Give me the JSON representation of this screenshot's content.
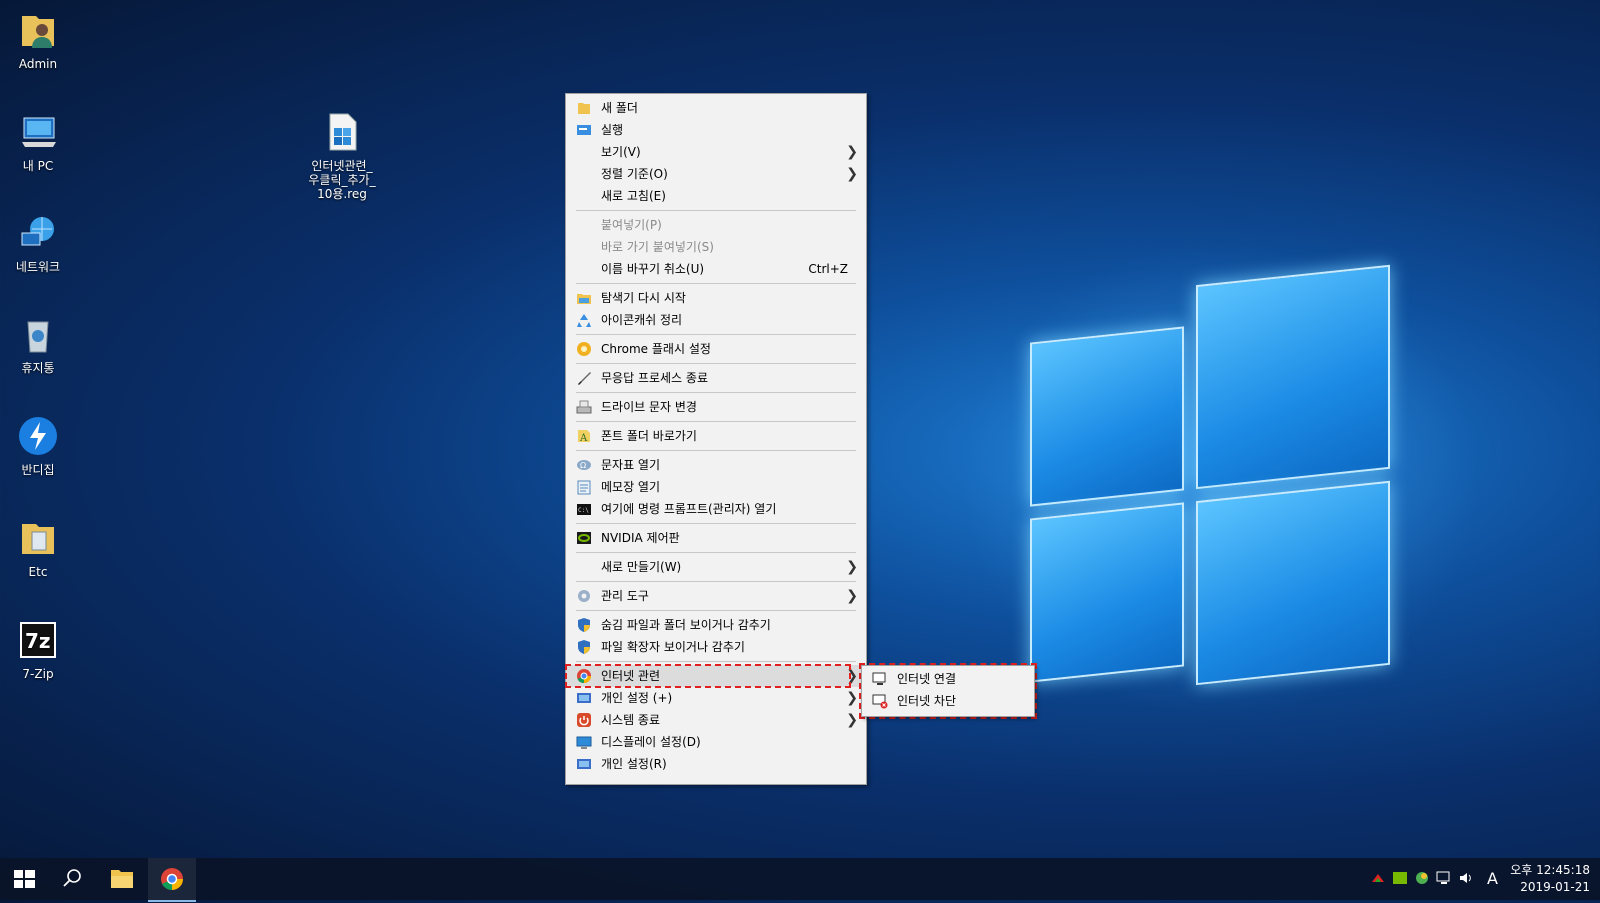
{
  "desktop": {
    "icons": [
      {
        "label": "Admin"
      },
      {
        "label": "내 PC"
      },
      {
        "label": "네트워크"
      },
      {
        "label": "휴지통"
      },
      {
        "label": "반디집"
      },
      {
        "label": "Etc"
      },
      {
        "label": "7-Zip"
      }
    ],
    "file_icon": {
      "line1": "인터넷관련_",
      "line2": "우클릭_추가_",
      "line3": "10용.reg"
    }
  },
  "context_menu": {
    "items": [
      {
        "label": "새 폴더",
        "icon": "folder-icon"
      },
      {
        "label": "실행",
        "icon": "run-icon"
      },
      {
        "label": "보기(V)",
        "submenu": true
      },
      {
        "label": "정렬 기준(O)",
        "submenu": true
      },
      {
        "label": "새로 고침(E)"
      },
      {
        "label": "붙여넣기(P)",
        "disabled": true
      },
      {
        "label": "바로 가기 붙여넣기(S)",
        "disabled": true
      },
      {
        "label": "이름 바꾸기 취소(U)",
        "shortcut": "Ctrl+Z"
      },
      {
        "label": "탐색기 다시 시작",
        "icon": "explorer-icon"
      },
      {
        "label": "아이콘캐쉬 정리",
        "icon": "recycle-icon"
      },
      {
        "label": "Chrome 플래시 설정",
        "icon": "chrome-flash-icon"
      },
      {
        "label": "무응답 프로세스 종료",
        "icon": "brush-icon"
      },
      {
        "label": "드라이브 문자 변경",
        "icon": "drive-icon"
      },
      {
        "label": "폰트 폴더 바로가기",
        "icon": "font-icon"
      },
      {
        "label": "문자표 열기",
        "icon": "charmap-icon"
      },
      {
        "label": "메모장 열기",
        "icon": "notepad-icon"
      },
      {
        "label": "여기에 명령 프롬프트(관리자) 열기",
        "icon": "cmd-icon"
      },
      {
        "label": "NVIDIA 제어판",
        "icon": "nvidia-icon"
      },
      {
        "label": "새로 만들기(W)",
        "submenu": true
      },
      {
        "label": "관리 도구",
        "submenu": true,
        "icon": "gear-icon"
      },
      {
        "label": "숨김 파일과 폴더 보이거나 감추기",
        "icon": "shield-icon"
      },
      {
        "label": "파일 확장자 보이거나 감추기",
        "icon": "shield-icon"
      },
      {
        "label": "인터넷 관련",
        "submenu": true,
        "icon": "chrome-icon",
        "highlighted": true
      },
      {
        "label": "개인 설정 (+)",
        "submenu": true,
        "icon": "personalize-icon"
      },
      {
        "label": "시스템 종료",
        "submenu": true,
        "icon": "power-icon"
      },
      {
        "label": "디스플레이 설정(D)",
        "icon": "display-icon"
      },
      {
        "label": "개인 설정(R)",
        "icon": "personalize-icon"
      }
    ]
  },
  "submenu": {
    "items": [
      {
        "label": "인터넷 연결",
        "icon": "network-connect-icon"
      },
      {
        "label": "인터넷 차단",
        "icon": "network-block-icon"
      }
    ]
  },
  "taskbar": {
    "tray_lang": "A",
    "clock_time": "오후 12:45:18",
    "clock_date": "2019-01-21"
  },
  "colors": {
    "highlight_border": "#e02020",
    "menu_bg": "#f2f2f2",
    "taskbar": "#0a1428"
  }
}
